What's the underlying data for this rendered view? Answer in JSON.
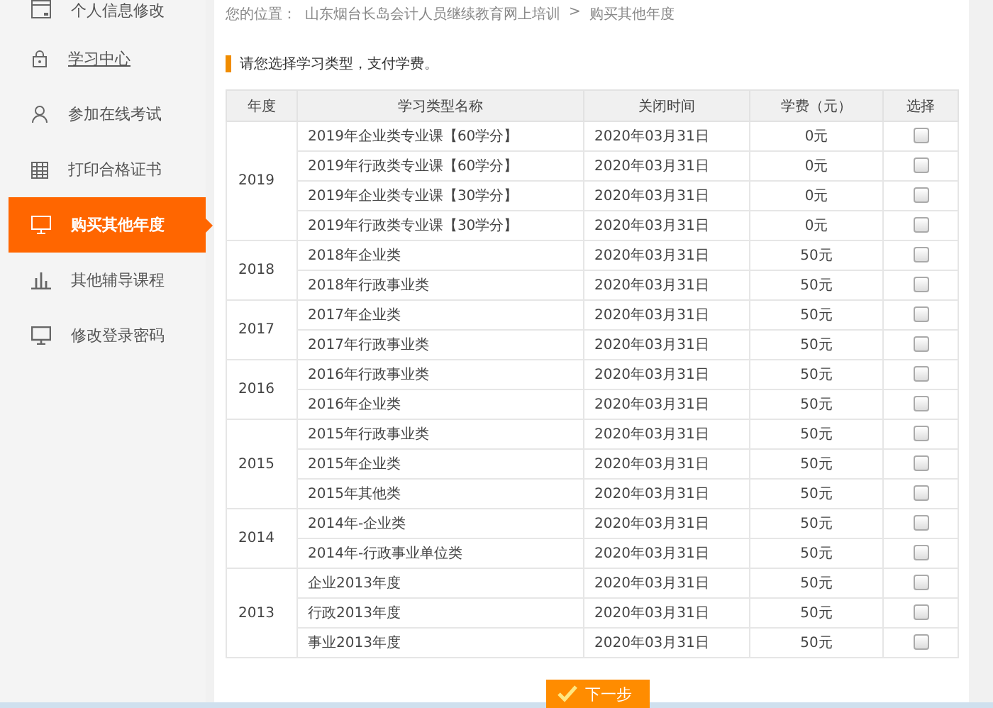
{
  "sidebar": {
    "items": [
      {
        "label": "个人信息修改",
        "selected": false,
        "link": false
      },
      {
        "label": "学习中心",
        "selected": false,
        "link": true
      },
      {
        "label": "参加在线考试",
        "selected": false,
        "link": false
      },
      {
        "label": "打印合格证书",
        "selected": false,
        "link": false
      },
      {
        "label": "购买其他年度",
        "selected": true,
        "link": false
      },
      {
        "label": "其他辅导课程",
        "selected": false,
        "link": false
      },
      {
        "label": "修改登录密码",
        "selected": false,
        "link": false
      }
    ]
  },
  "breadcrumb": {
    "label": "您的位置：",
    "trail": [
      "山东烟台长岛会计人员继续教育网上培训",
      "购买其他年度"
    ],
    "separator": ">"
  },
  "heading": "请您选择学习类型，支付学费。",
  "table": {
    "columns": [
      "年度",
      "学习类型名称",
      "关闭时间",
      "学费（元）",
      "选择"
    ],
    "groups": [
      {
        "year": "2019",
        "rows": [
          {
            "name": "2019年企业类专业课【60学分】",
            "close_time": "2020年03月31日",
            "fee": "0元",
            "checked": false
          },
          {
            "name": "2019年行政类专业课【60学分】",
            "close_time": "2020年03月31日",
            "fee": "0元",
            "checked": false
          },
          {
            "name": "2019年企业类专业课【30学分】",
            "close_time": "2020年03月31日",
            "fee": "0元",
            "checked": false
          },
          {
            "name": "2019年行政类专业课【30学分】",
            "close_time": "2020年03月31日",
            "fee": "0元",
            "checked": false
          }
        ]
      },
      {
        "year": "2018",
        "rows": [
          {
            "name": "2018年企业类",
            "close_time": "2020年03月31日",
            "fee": "50元",
            "checked": false
          },
          {
            "name": "2018年行政事业类",
            "close_time": "2020年03月31日",
            "fee": "50元",
            "checked": false
          }
        ]
      },
      {
        "year": "2017",
        "rows": [
          {
            "name": "2017年企业类",
            "close_time": "2020年03月31日",
            "fee": "50元",
            "checked": false
          },
          {
            "name": "2017年行政事业类",
            "close_time": "2020年03月31日",
            "fee": "50元",
            "checked": false
          }
        ]
      },
      {
        "year": "2016",
        "rows": [
          {
            "name": "2016年行政事业类",
            "close_time": "2020年03月31日",
            "fee": "50元",
            "checked": false
          },
          {
            "name": "2016年企业类",
            "close_time": "2020年03月31日",
            "fee": "50元",
            "checked": false
          }
        ]
      },
      {
        "year": "2015",
        "rows": [
          {
            "name": "2015年行政事业类",
            "close_time": "2020年03月31日",
            "fee": "50元",
            "checked": false
          },
          {
            "name": "2015年企业类",
            "close_time": "2020年03月31日",
            "fee": "50元",
            "checked": false
          },
          {
            "name": "2015年其他类",
            "close_time": "2020年03月31日",
            "fee": "50元",
            "checked": false
          }
        ]
      },
      {
        "year": "2014",
        "rows": [
          {
            "name": "2014年-企业类",
            "close_time": "2020年03月31日",
            "fee": "50元",
            "checked": false
          },
          {
            "name": "2014年-行政事业单位类",
            "close_time": "2020年03月31日",
            "fee": "50元",
            "checked": false
          }
        ]
      },
      {
        "year": "2013",
        "rows": [
          {
            "name": "企业2013年度",
            "close_time": "2020年03月31日",
            "fee": "50元",
            "checked": false
          },
          {
            "name": "行政2013年度",
            "close_time": "2020年03月31日",
            "fee": "50元",
            "checked": false
          },
          {
            "name": "事业2013年度",
            "close_time": "2020年03月31日",
            "fee": "50元",
            "checked": false
          }
        ]
      }
    ]
  },
  "next_button": "下一步"
}
